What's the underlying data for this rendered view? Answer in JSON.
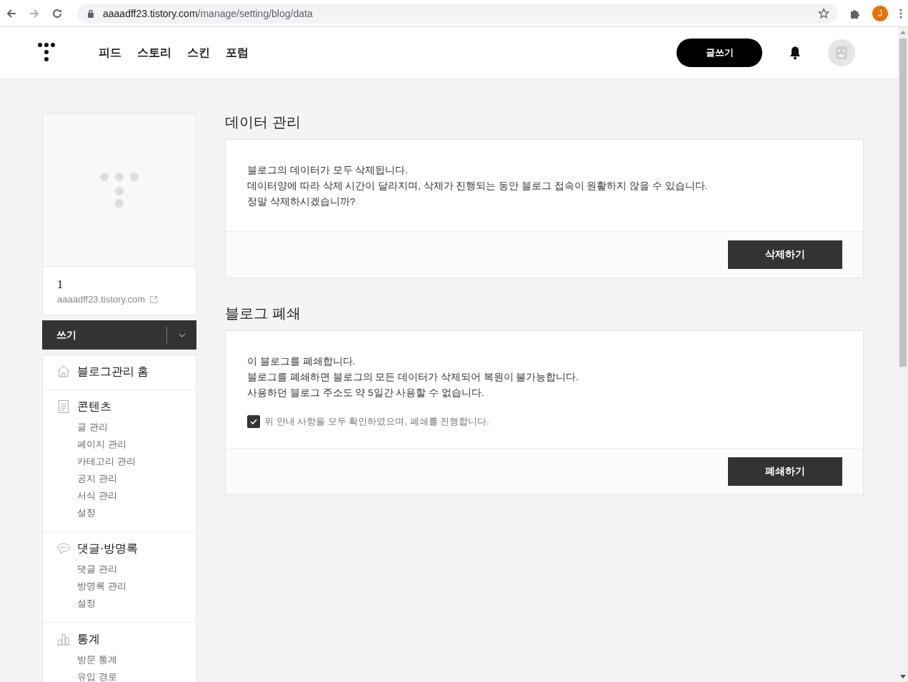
{
  "browser": {
    "url_host": "aaaadff23.tistory.com",
    "url_path": "/manage/setting/blog/data",
    "profile_initial": "J"
  },
  "nav": {
    "items": [
      {
        "label": "피드"
      },
      {
        "label": "스토리"
      },
      {
        "label": "스킨"
      },
      {
        "label": "포럼"
      }
    ],
    "write_button": "글쓰기"
  },
  "sidebar": {
    "blog_title": "1",
    "blog_url": "aaaadff23.tistory.com",
    "write_button": "쓰기",
    "menu": [
      {
        "label": "블로그관리 홈",
        "kind": "home"
      },
      {
        "label": "콘텐츠",
        "kind": "document",
        "children": [
          {
            "label": "글 관리"
          },
          {
            "label": "페이지 관리"
          },
          {
            "label": "카테고리 관리"
          },
          {
            "label": "공지 관리"
          },
          {
            "label": "서식 관리"
          },
          {
            "label": "설정"
          }
        ]
      },
      {
        "label": "댓글·방명록",
        "kind": "comment",
        "children": [
          {
            "label": "댓글 관리"
          },
          {
            "label": "방명록 관리"
          },
          {
            "label": "설정"
          }
        ]
      },
      {
        "label": "통계",
        "kind": "chart",
        "children": [
          {
            "label": "방문 통계"
          },
          {
            "label": "유입 경로"
          }
        ]
      }
    ]
  },
  "sections": [
    {
      "title": "데이터 관리",
      "lines": [
        "블로그의 데이터가 모두 삭제됩니다.",
        "데이터양에 따라 삭제 시간이 달라지며, 삭제가 진행되는 동안 블로그 접속이 원활하지 않을 수 있습니다.",
        "정말 삭제하시겠습니까?"
      ],
      "button": "삭제하기"
    },
    {
      "title": "블로그 폐쇄",
      "lines": [
        "이 블로그를 폐쇄합니다.",
        "블로그를 폐쇄하면 블로그의 모든 데이터가 삭제되어 복원이 불가능합니다.",
        "사용하던 블로그 주소도 약 5일간 사용할 수 없습니다."
      ],
      "checkbox": {
        "label": "위 안내 사항을 모두 확인하였으며, 폐쇄를 진행합니다.",
        "checked": true
      },
      "button": "폐쇄하기"
    }
  ]
}
